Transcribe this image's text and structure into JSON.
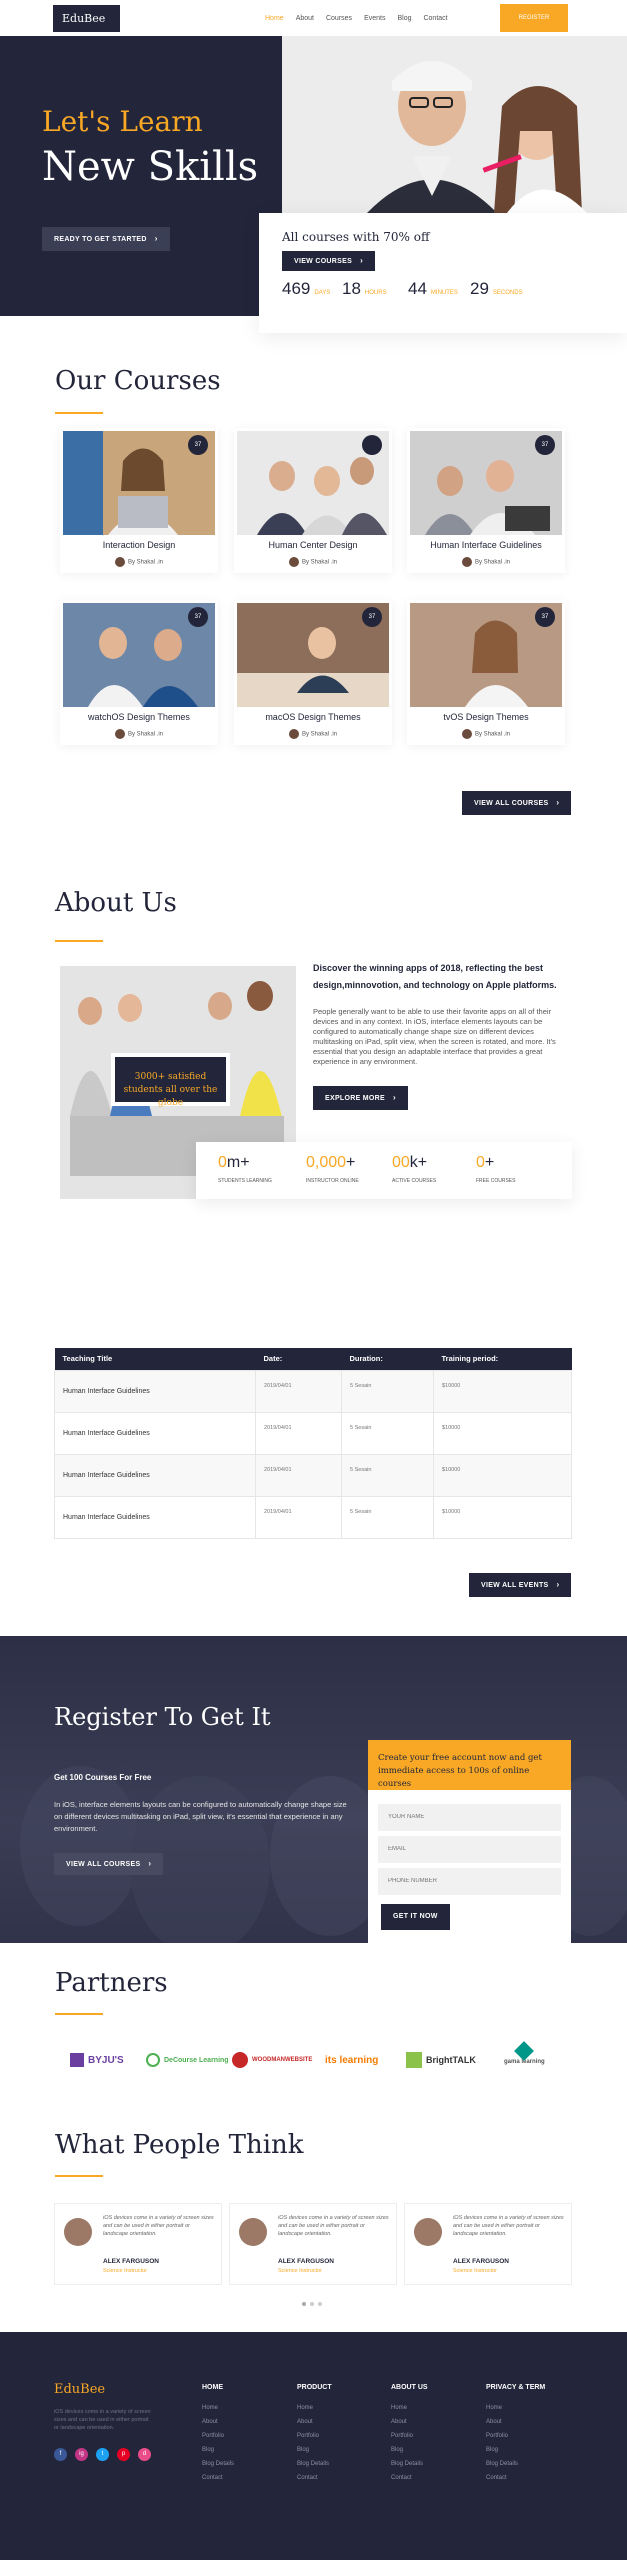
{
  "colors": {
    "navy": "#23263a",
    "accent": "#f9a825"
  },
  "header": {
    "logo": "EduBee",
    "nav": [
      "Home",
      "About",
      "Courses",
      "Events",
      "Blog",
      "Contact"
    ],
    "active_nav": "Home",
    "register": "Register"
  },
  "hero": {
    "tagline": "Let's Learn",
    "title": "New Skills",
    "cta": "Ready to get started",
    "promo": "All courses with 70% off",
    "view_courses": "View Courses",
    "stats": [
      {
        "num": "469",
        "label": "Days"
      },
      {
        "num": "18",
        "label": "Hours"
      },
      {
        "num": "44",
        "label": "Minutes"
      },
      {
        "num": "29",
        "label": "Seconds"
      }
    ]
  },
  "courses": {
    "title": "Our Courses",
    "items": [
      {
        "title": "Interaction Design",
        "author": "By Shakal .in",
        "badge": "37"
      },
      {
        "title": "Human Center Design",
        "author": "By Shakal .in",
        "badge": ""
      },
      {
        "title": "Human Interface Guidelines",
        "author": "By Shakal .in",
        "badge": "37"
      },
      {
        "title": "watchOS Design Themes",
        "author": "By Shakal .in",
        "badge": "37"
      },
      {
        "title": "macOS Design Themes",
        "author": "By Shakal .in",
        "badge": "37"
      },
      {
        "title": "tvOS Design Themes",
        "author": "By Shakal .in",
        "badge": "37"
      }
    ],
    "view_all": "View All Courses"
  },
  "about": {
    "title": "About Us",
    "badge": "3000+ satisfied students all over the globe",
    "heading": "Discover the winning apps of 2018, reflecting the best design,minnovotion, and technology on Apple platforms.",
    "body": "People generally want to be able to use their favorite apps on all of their devices and in any context. In iOS, interface elements layouts can be configured to automatically change shape size on different devices multitasking on iPad, split view, when the screen is rotated, and more. It's essential that you design an adaptable interface that provides a great experience in any environment.",
    "explore": "Explore More",
    "stats": [
      {
        "num": "0",
        "plus": "m+",
        "label": "Students Learning"
      },
      {
        "num": "0,000",
        "plus": "+",
        "label": "Instructor Online"
      },
      {
        "num": "00",
        "plus": "k+",
        "label": "Active Courses"
      },
      {
        "num": "0",
        "plus": "+",
        "label": "Free Courses"
      }
    ]
  },
  "events": {
    "headers": [
      "Teaching Title",
      "Date:",
      "Duration:",
      "Training period:"
    ],
    "rows": [
      [
        "Human Interface Guidelines",
        "2019/04/01",
        "5 Sesain",
        "$10000"
      ],
      [
        "Human Interface Guidelines",
        "2019/04/01",
        "5 Sesain",
        "$10000"
      ],
      [
        "Human Interface Guidelines",
        "2019/04/01",
        "5 Sesain",
        "$10000"
      ],
      [
        "Human Interface Guidelines",
        "2019/04/01",
        "5 Sesain",
        "$10000"
      ]
    ],
    "view_all": "View All Events"
  },
  "register": {
    "title": "Register To Get It",
    "subtitle": "Get 100 Courses For Free",
    "body": "In iOS, interface elements layouts can be configured to automatically change shape size on different devices multitasking on iPad, split view, it's essential that experience in any environment.",
    "view_all": "View All Courses",
    "form_head": "Create your free account now and get immediate access to 100s of online courses",
    "fields": [
      "Your Name",
      "Email",
      "Phone Number"
    ],
    "submit": "Get It Now"
  },
  "partners": {
    "title": "Partners",
    "logos": [
      "BYJU'S",
      "DeCourse Learning",
      "WOODMANWEBSITE",
      "its learning",
      "BrightTALK",
      "gama learning"
    ]
  },
  "testimonials": {
    "title": "What People Think",
    "items": [
      {
        "quote": "iOS devices come in a variety of screen sizes and can be used in either portrait or landscape orientation.",
        "name": "ALEX FARGUSON",
        "role": "Science Instructor"
      },
      {
        "quote": "iOS devices come in a variety of screen sizes and can be used in either portrait or landscape orientation.",
        "name": "ALEX FARGUSON",
        "role": "Science Instructor"
      },
      {
        "quote": "iOS devices come in a variety of screen sizes and can be used in either portrait or landscape orientation.",
        "name": "ALEX FARGUSON",
        "role": "Science Instructor"
      }
    ]
  },
  "footer": {
    "logo": "EduBee",
    "about": "iOS devices come in a variety of screen sizes and can be used in either portrait or landscape orientation.",
    "social": [
      "f",
      "ig",
      "t",
      "p",
      "d"
    ],
    "columns": [
      {
        "title": "Home",
        "links": [
          "Home",
          "About",
          "Portfolio",
          "Blog",
          "Blog Details",
          "Contact"
        ]
      },
      {
        "title": "Product",
        "links": [
          "Home",
          "About",
          "Portfolio",
          "Blog",
          "Blog Details",
          "Contact"
        ]
      },
      {
        "title": "About Us",
        "links": [
          "Home",
          "About",
          "Portfolio",
          "Blog",
          "Blog Details",
          "Contact"
        ]
      },
      {
        "title": "Privacy & Term",
        "links": [
          "Home",
          "About",
          "Portfolio",
          "Blog",
          "Blog Details",
          "Contact"
        ]
      }
    ]
  }
}
